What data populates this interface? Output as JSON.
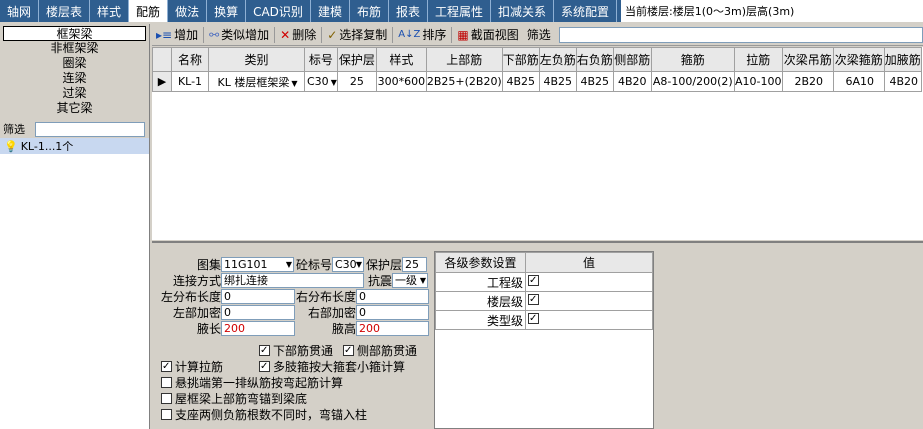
{
  "tabs": [
    "轴网",
    "楼层表",
    "样式",
    "配筋",
    "做法",
    "换算",
    "CAD识别",
    "建模",
    "布筋",
    "报表",
    "工程属性",
    "扣减关系",
    "系统配置"
  ],
  "active_tab": "配筋",
  "floor_info": "当前楼层:楼层1(0～3m)层高(3m)",
  "left": {
    "categories": [
      "框架梁",
      "非框架梁",
      "圈梁",
      "连梁",
      "过梁",
      "其它梁"
    ],
    "filter_label": "筛选",
    "tree_item": "KL-1...1个"
  },
  "toolbar": {
    "add": "增加",
    "similar_add": "类似增加",
    "delete": "删除",
    "select_copy": "选择复制",
    "sort": "排序",
    "section_view": "截面视图",
    "filter": "筛选"
  },
  "grid": {
    "headers": [
      "名称",
      "类别",
      "标号",
      "保护层",
      "样式",
      "上部筋",
      "下部筋",
      "左负筋",
      "右负筋",
      "侧部筋",
      "箍筋",
      "拉筋",
      "次梁吊筋",
      "次梁箍筋",
      "加腋筋"
    ],
    "rows": [
      [
        "KL-1",
        "KL  楼层框架梁",
        "C30",
        "25",
        "300*600",
        "2B25+(2B20)",
        "4B25",
        "4B25",
        "4B25",
        "4B20",
        "A8-100/200(2)",
        "A10-100",
        "2B20",
        "6A10",
        "4B20"
      ]
    ]
  },
  "form": {
    "atlas_label": "图集",
    "atlas_value": "11G101",
    "concrete_label": "砼标号",
    "concrete_value": "C30",
    "cover_label": "保护层",
    "cover_value": "25",
    "connect_label": "连接方式",
    "connect_value": "绑扎连接",
    "seismic_label": "抗震",
    "seismic_value": "一级",
    "left_dist_label": "左分布长度",
    "left_dist_value": "0",
    "right_dist_label": "右分布长度",
    "right_dist_value": "0",
    "left_dense_label": "左部加密",
    "left_dense_value": "0",
    "right_dense_label": "右部加密",
    "right_dense_value": "0",
    "haunch_len_label": "腋长",
    "haunch_len_value": "200",
    "haunch_h_label": "腋高",
    "haunch_h_value": "200",
    "chk_bottom_through": "下部筋贯通",
    "chk_side_through": "侧部筋贯通",
    "chk_calc_tie": "计算拉筋",
    "chk_multi_leg": "多肢箍按大箍套小箍计算",
    "chk_cantilever": "悬挑端第一排纵筋按弯起筋计算",
    "chk_roof_top": "屋框梁上部筋弯锚到梁底",
    "chk_support": "支座两侧负筋根数不同时，弯锚入柱"
  },
  "level_table": {
    "headers": [
      "各级参数设置",
      "值"
    ],
    "rows": [
      {
        "name": "工程级",
        "checked": true
      },
      {
        "name": "楼层级",
        "checked": true
      },
      {
        "name": "类型级",
        "checked": true
      }
    ]
  }
}
